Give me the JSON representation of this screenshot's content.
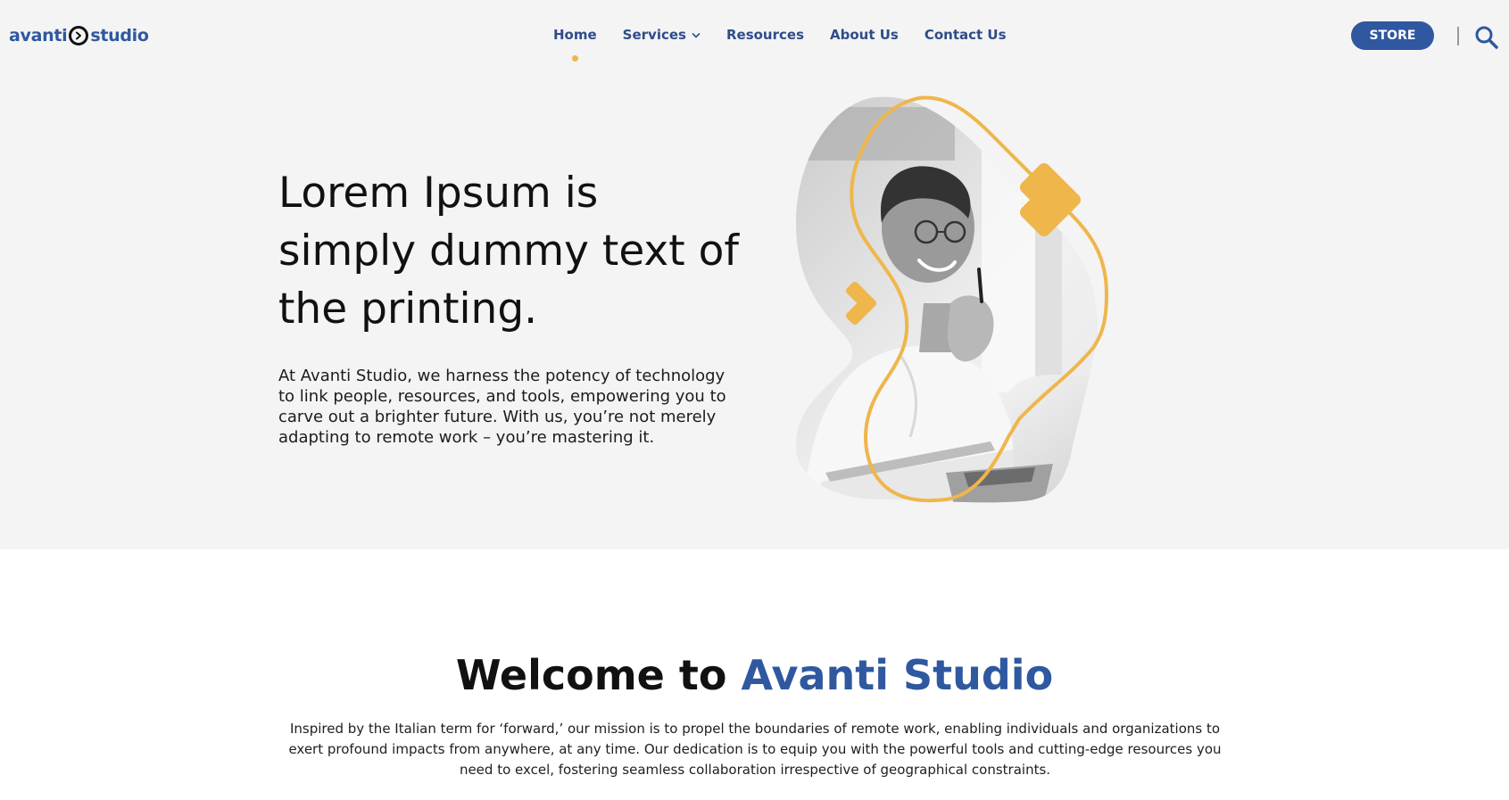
{
  "brand": {
    "part1": "avanti",
    "part2": "studio",
    "color": "#2f58a0"
  },
  "nav": {
    "items": [
      {
        "label": "Home",
        "active": true
      },
      {
        "label": "Services",
        "has_dropdown": true
      },
      {
        "label": "Resources"
      },
      {
        "label": "About Us"
      },
      {
        "label": "Contact Us"
      }
    ],
    "active_indicator_color": "#efb64b"
  },
  "header": {
    "store_label": "STORE",
    "search_icon": "search-icon"
  },
  "hero": {
    "title": "Lorem Ipsum is simply dummy text of the printing.",
    "body": "At Avanti Studio, we harness the potency of technology to link people, resources, and tools, empowering you to carve out a brighter future. With us, you’re not merely adapting to remote work – you’re mastering it.",
    "accent_color": "#efb64b"
  },
  "welcome": {
    "title_prefix": "Welcome to",
    "title_accent": "Avanti Studio",
    "body": "Inspired by the Italian term for ‘forward,’ our mission is to propel the boundaries of remote work, enabling individuals and organizations to exert profound impacts from anywhere, at any time. Our dedication is to equip you with the powerful tools and cutting-edge resources you need to excel, fostering seamless collaboration irrespective of geographical constraints."
  }
}
